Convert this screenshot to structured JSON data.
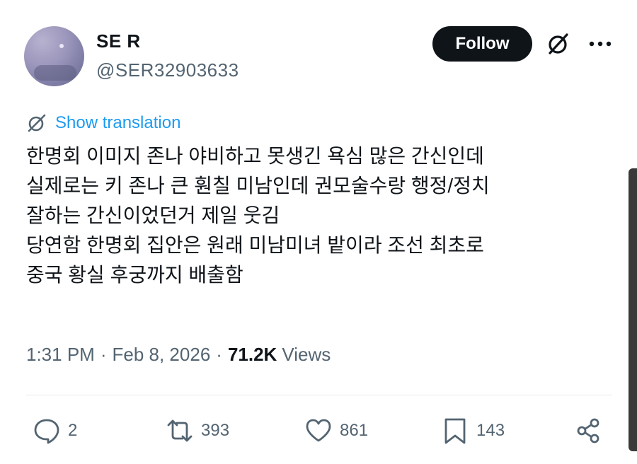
{
  "author": {
    "display_name": "SE R",
    "handle": "@SER32903633"
  },
  "header": {
    "follow_label": "Follow",
    "grok_icon": "grok-icon",
    "more_icon": "more-icon"
  },
  "translation": {
    "label": "Show translation",
    "link_color": "#1d9bf0"
  },
  "tweet": {
    "lines": [
      "한명회 이미지 존나 야비하고 못생긴 욕심 많은 간신인데",
      "실제로는 키 존나 큰 훤칠 미남인데 권모술수랑 행정/정치",
      "잘하는 간신이었던거 제일 웃김",
      "당연함 한명회 집안은 원래 미남미녀 밭이라 조선 최초로",
      "중국 황실 후궁까지 배출함"
    ]
  },
  "meta": {
    "time": "1:31 PM",
    "date": "Feb 8, 2026",
    "separator": "·",
    "views_count": "71.2K",
    "views_label": "Views"
  },
  "actions": {
    "replies": "2",
    "reposts": "393",
    "likes": "861",
    "bookmarks": "143"
  },
  "colors": {
    "text_primary": "#0f1419",
    "text_secondary": "#536471",
    "accent": "#1d9bf0"
  }
}
